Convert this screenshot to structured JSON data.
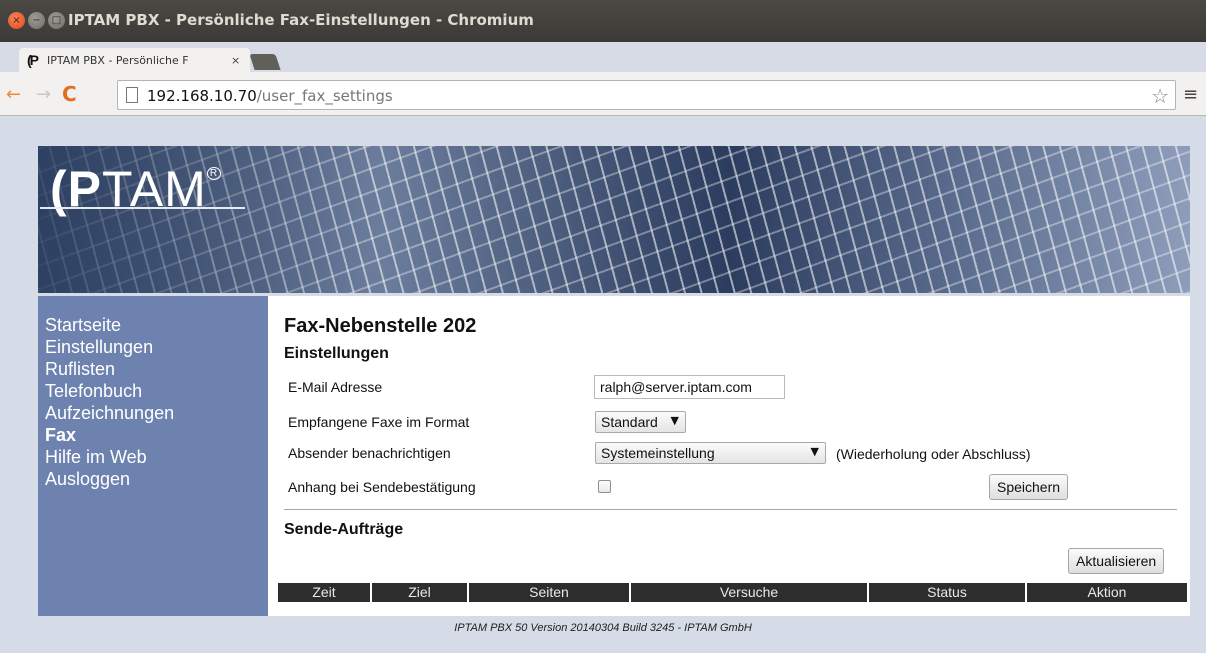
{
  "window": {
    "title": "IPTAM PBX - Persönliche Fax-Einstellungen - Chromium",
    "close_glyph": "×",
    "min_glyph": "−",
    "max_glyph": "□"
  },
  "tab": {
    "favicon_text": "(P",
    "title": "IPTAM PBX - Persönliche F",
    "close_glyph": "×"
  },
  "toolbar": {
    "back_glyph": "←",
    "forward_glyph": "→",
    "reload_glyph": "C",
    "url_host": "192.168.10.70",
    "url_path": "/user_fax_settings",
    "star_glyph": "☆",
    "menu_glyph": "≡"
  },
  "banner": {
    "logo_bold": "(P",
    "logo_text": "TAM",
    "logo_reg": "R"
  },
  "sidebar": {
    "items": [
      {
        "label": "Startseite"
      },
      {
        "label": "Einstellungen"
      },
      {
        "label": "Ruflisten"
      },
      {
        "label": "Telefonbuch"
      },
      {
        "label": "Aufzeichnungen"
      },
      {
        "label": "Fax"
      },
      {
        "label": "Hilfe im Web"
      },
      {
        "label": "Ausloggen"
      }
    ]
  },
  "content": {
    "title": "Fax-Nebenstelle 202",
    "settings_heading": "Einstellungen",
    "email_label": "E-Mail Adresse",
    "email_value": "ralph@server.iptam.com",
    "format_label": "Empfangene Faxe im Format",
    "format_value": "Standard",
    "notify_label": "Absender benachrichtigen",
    "notify_value": "Systemeinstellung",
    "notify_hint": "(Wiederholung oder Abschluss)",
    "attachment_label": "Anhang bei Sendebestätigung",
    "save_button": "Speichern",
    "jobs_heading": "Sende-Aufträge",
    "refresh_button": "Aktualisieren",
    "columns": [
      "Zeit",
      "Ziel",
      "Seiten",
      "Versuche",
      "Status",
      "Aktion"
    ],
    "select_arrow": "▼"
  },
  "footer": {
    "text": "IPTAM PBX 50 Version 20140304 Build 3245 - IPTAM GmbH"
  }
}
